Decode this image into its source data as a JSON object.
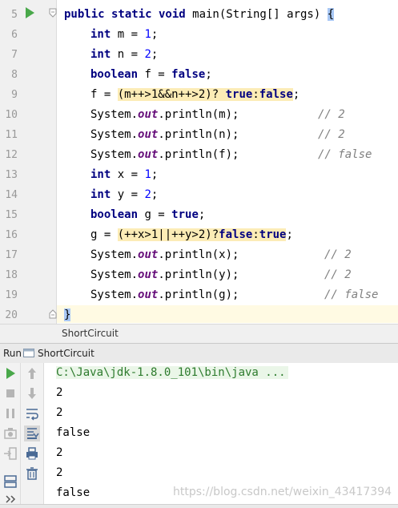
{
  "editor": {
    "line_numbers": [
      "5",
      "6",
      "7",
      "8",
      "9",
      "10",
      "11",
      "12",
      "13",
      "14",
      "15",
      "16",
      "17",
      "18",
      "19",
      "20"
    ],
    "lines": {
      "l5": {
        "kw1": "public static void",
        "rest": " main(String[] args) ",
        "brace": "{"
      },
      "l6": {
        "kw": "int",
        "rest": " m = ",
        "num": "1",
        "end": ";"
      },
      "l7": {
        "kw": "int",
        "rest": " n = ",
        "num": "2",
        "end": ";"
      },
      "l8": {
        "kw": "boolean",
        "rest": " f = ",
        "kw2": "false",
        "end": ";"
      },
      "l9": {
        "a": "f = ",
        "hl": "(m++>1&&n++>2)",
        "b": "? ",
        "kw1": "true",
        "c": ":",
        "kw2": "false",
        "end": ";"
      },
      "l10": {
        "a": "System.",
        "fld": "out",
        "b": ".println(m);",
        "cmt": "// 2"
      },
      "l11": {
        "a": "System.",
        "fld": "out",
        "b": ".println(n);",
        "cmt": "// 2"
      },
      "l12": {
        "a": "System.",
        "fld": "out",
        "b": ".println(f);",
        "cmt": "// false"
      },
      "l13": {
        "kw": "int",
        "rest": " x = ",
        "num": "1",
        "end": ";"
      },
      "l14": {
        "kw": "int",
        "rest": " y = ",
        "num": "2",
        "end": ";"
      },
      "l15": {
        "kw": "boolean",
        "rest": " g = ",
        "kw2": "true",
        "end": ";"
      },
      "l16": {
        "a": "g = ",
        "hl": "(++x>1||++y>2)",
        "b": "?",
        "kw1": "false",
        "c": ":",
        "kw2": "true",
        "end": ";"
      },
      "l17": {
        "a": "System.",
        "fld": "out",
        "b": ".println(x);",
        "cmt": "// 2"
      },
      "l18": {
        "a": "System.",
        "fld": "out",
        "b": ".println(y);",
        "cmt": "// 2"
      },
      "l19": {
        "a": "System.",
        "fld": "out",
        "b": ".println(g);",
        "cmt": "// false"
      },
      "l20": {
        "brace": "}"
      }
    }
  },
  "breadcrumb": {
    "label": "ShortCircuit"
  },
  "run_panel": {
    "run_label": "Run",
    "tab_label": "ShortCircuit",
    "command": "C:\\Java\\jdk-1.8.0_101\\bin\\java ...",
    "output": [
      "2",
      "2",
      "false",
      "2",
      "2",
      "false"
    ]
  },
  "watermark": "https://blog.csdn.net/weixin_43417394",
  "colors": {
    "keyword": "#000080",
    "number": "#0000ff",
    "field": "#660e7a",
    "comment": "#808080",
    "highlight": "#fcecb6",
    "run_green": "#49a84a"
  }
}
